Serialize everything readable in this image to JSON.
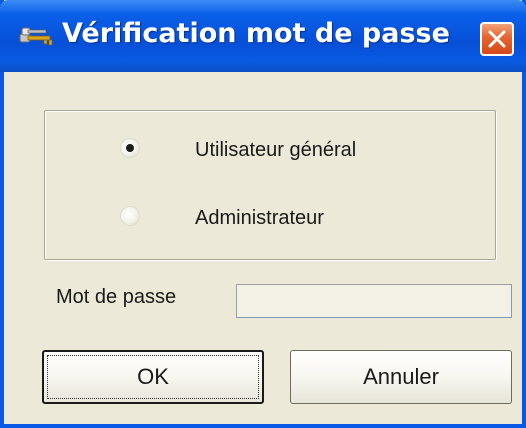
{
  "window": {
    "title": "Vérification mot de passe",
    "title_icon": "keys-icon",
    "close_icon": "close-icon"
  },
  "user_type": {
    "options": [
      {
        "label": "Utilisateur général",
        "selected": true
      },
      {
        "label": "Administrateur",
        "selected": false
      }
    ]
  },
  "password": {
    "label": "Mot de passe",
    "value": ""
  },
  "buttons": {
    "ok_label": "OK",
    "cancel_label": "Annuler"
  },
  "colors": {
    "titlebar": "#0750d8",
    "window_bg": "#ece9d8",
    "close_button": "#e5642f"
  }
}
